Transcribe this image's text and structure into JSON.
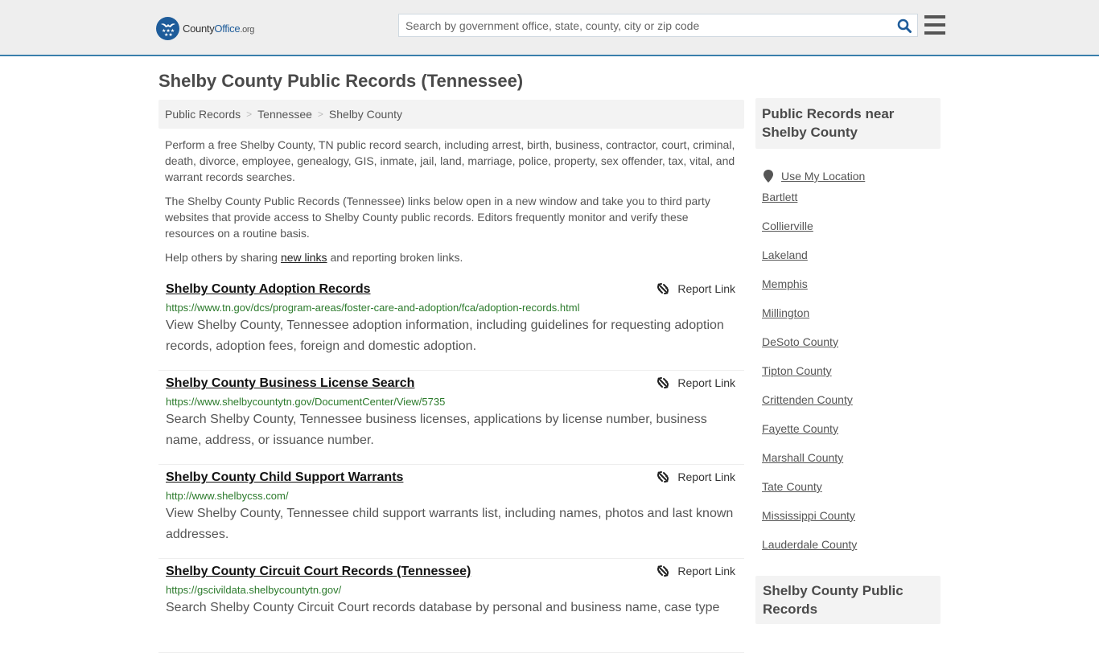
{
  "header": {
    "logo": {
      "brand_main": "County",
      "brand_accent": "Office",
      "brand_tld": ".org"
    },
    "search": {
      "placeholder": "Search by government office, state, county, city or zip code",
      "value": ""
    },
    "icons": {
      "search": "search-icon",
      "menu": "hamburger-menu-icon",
      "logo": "eagle-stars-logo-icon"
    },
    "colors": {
      "accent": "#1e5c9a",
      "header_border": "#3a7fab",
      "url_green": "#2b7a2b"
    }
  },
  "page": {
    "title": "Shelby County Public Records (Tennessee)",
    "breadcrumb": [
      {
        "label": "Public Records"
      },
      {
        "label": "Tennessee"
      },
      {
        "label": "Shelby County"
      }
    ],
    "breadcrumb_separator": ">",
    "intro": {
      "p1": "Perform a free Shelby County, TN public record search, including arrest, birth, business, contractor, court, criminal, death, divorce, employee, genealogy, GIS, inmate, jail, land, marriage, police, property, sex offender, tax, vital, and warrant records searches.",
      "p2": "The Shelby County Public Records (Tennessee) links below open in a new window and take you to third party websites that provide access to Shelby County public records. Editors frequently monitor and verify these resources on a routine basis.",
      "p3_before": "Help others by sharing ",
      "p3_link": "new links",
      "p3_after": " and reporting broken links."
    }
  },
  "results": [
    {
      "title": "Shelby County Adoption Records",
      "url": "https://www.tn.gov/dcs/program-areas/foster-care-and-adoption/fca/adoption-records.html",
      "description": "View Shelby County, Tennessee adoption information, including guidelines for requesting adoption records, adoption fees, foreign and domestic adoption.",
      "report_label": "Report Link"
    },
    {
      "title": "Shelby County Business License Search",
      "url": "https://www.shelbycountytn.gov/DocumentCenter/View/5735",
      "description": "Search Shelby County, Tennessee business licenses, applications by license number, business name, address, or issuance number.",
      "report_label": "Report Link"
    },
    {
      "title": "Shelby County Child Support Warrants",
      "url": "http://www.shelbycss.com/",
      "description": "View Shelby County, Tennessee child support warrants list, including names, photos and last known addresses.",
      "report_label": "Report Link"
    },
    {
      "title": "Shelby County Circuit Court Records (Tennessee)",
      "url": "https://gscivildata.shelbycountytn.gov/",
      "description": "Search Shelby County Circuit Court records database by personal and business name, case type",
      "report_label": "Report Link"
    }
  ],
  "sidebar": {
    "heading": "Public Records near Shelby County",
    "use_location": "Use My Location",
    "items": [
      {
        "label": "Bartlett"
      },
      {
        "label": "Collierville"
      },
      {
        "label": "Lakeland"
      },
      {
        "label": "Memphis"
      },
      {
        "label": "Millington"
      },
      {
        "label": "DeSoto County"
      },
      {
        "label": "Tipton County"
      },
      {
        "label": "Crittenden County"
      },
      {
        "label": "Fayette County"
      },
      {
        "label": "Marshall County"
      },
      {
        "label": "Tate County"
      },
      {
        "label": "Mississippi County"
      },
      {
        "label": "Lauderdale County"
      }
    ],
    "heading2": "Shelby County Public Records"
  }
}
